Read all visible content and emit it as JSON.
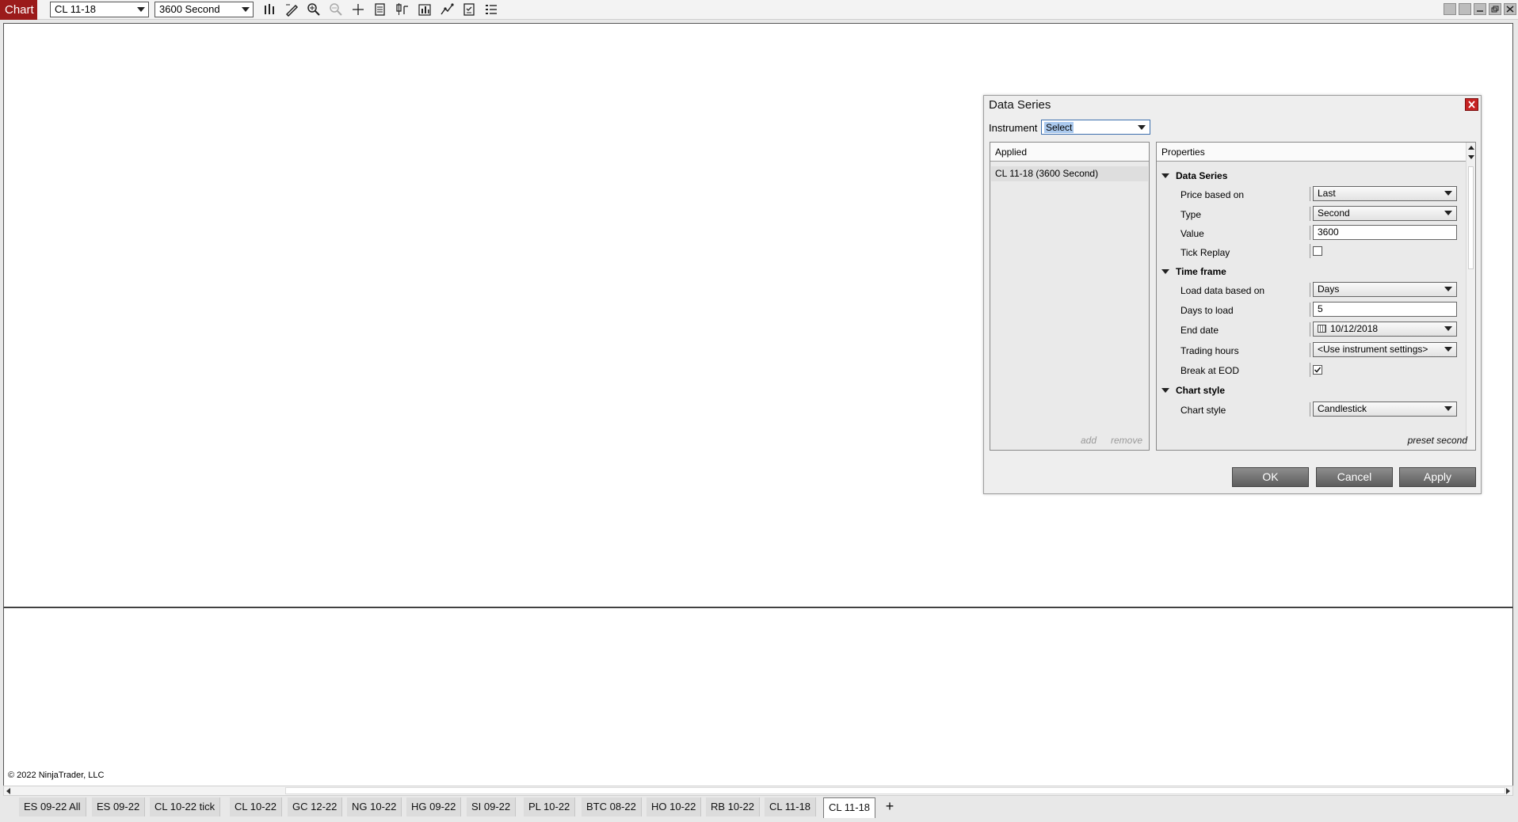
{
  "toolbar": {
    "chart_label": "Chart",
    "instrument": "CL 11-18",
    "interval": "3600 Second",
    "icons": [
      "bars-icon",
      "draw-pencil-icon",
      "zoom-in-icon",
      "zoom-out-icon",
      "crosshair-icon",
      "data-series-icon",
      "chart-style-icon",
      "indicators-icon",
      "strategy-icon",
      "properties-icon",
      "list-icon"
    ]
  },
  "window_buttons": [
    "tile-icon",
    "panel-icon",
    "minimize-icon",
    "restore-icon",
    "close-icon"
  ],
  "chart": {
    "copyright": "© 2022 NinjaTrader, LLC"
  },
  "tabs": [
    {
      "label": "ES 09-22 All",
      "active": false
    },
    {
      "label": "ES 09-22",
      "active": false
    },
    {
      "label": "CL 10-22 tick",
      "active": false
    },
    {
      "label": "CL 10-22",
      "active": false
    },
    {
      "label": "GC 12-22",
      "active": false
    },
    {
      "label": "NG 10-22",
      "active": false
    },
    {
      "label": "HG 09-22",
      "active": false
    },
    {
      "label": "SI 09-22",
      "active": false
    },
    {
      "label": "PL 10-22",
      "active": false
    },
    {
      "label": "BTC 08-22",
      "active": false
    },
    {
      "label": "HO 10-22",
      "active": false
    },
    {
      "label": "RB 10-22",
      "active": false
    },
    {
      "label": "CL 11-18",
      "active": false
    },
    {
      "label": "CL 11-18",
      "active": true
    }
  ],
  "tab_add": "+",
  "dialog": {
    "title": "Data Series",
    "instrument_label": "Instrument",
    "instrument_value": "Select",
    "applied": {
      "header": "Applied",
      "items": [
        "CL 11-18 (3600 Second)"
      ],
      "add": "add",
      "remove": "remove"
    },
    "properties": {
      "header": "Properties",
      "sections": {
        "data_series": "Data Series",
        "time_frame": "Time frame",
        "chart_style": "Chart style"
      },
      "rows": {
        "price_based_on": {
          "label": "Price based on",
          "value": "Last"
        },
        "type": {
          "label": "Type",
          "value": "Second"
        },
        "value": {
          "label": "Value",
          "value": "3600"
        },
        "tick_replay": {
          "label": "Tick Replay",
          "checked": false
        },
        "load_data_based_on": {
          "label": "Load data based on",
          "value": "Days"
        },
        "days_to_load": {
          "label": "Days to load",
          "value": "5"
        },
        "end_date": {
          "label": "End date",
          "value": "10/12/2018"
        },
        "trading_hours": {
          "label": "Trading hours",
          "value": "<Use instrument settings>"
        },
        "break_at_eod": {
          "label": "Break at EOD",
          "checked": true
        },
        "chart_style": {
          "label": "Chart style",
          "value": "Candlestick"
        }
      },
      "preset": "preset second"
    },
    "buttons": {
      "ok": "OK",
      "cancel": "Cancel",
      "apply": "Apply"
    }
  },
  "colors": {
    "chart_tab_bg": "#9b1b1b",
    "dialog_close": "#c62222",
    "selection": "#aac9ee"
  }
}
